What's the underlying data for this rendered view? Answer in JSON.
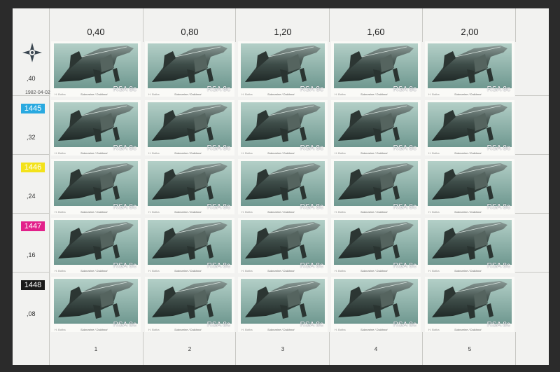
{
  "sheet": {
    "issue_date": "1982-04-02",
    "top_values": [
      "0,40",
      "0,80",
      "1,20",
      "1,60",
      "2,00"
    ],
    "row_values": [
      ",40",
      ",32",
      ",24",
      ",16",
      ",08"
    ],
    "column_numbers": [
      "1",
      "2",
      "3",
      "4",
      "5"
    ],
    "plate_numbers": [
      {
        "label": "1445",
        "color": "#29a9e0"
      },
      {
        "label": "1446",
        "color": "#f3e21a"
      },
      {
        "label": "1447",
        "color": "#e2208a"
      },
      {
        "label": "1448",
        "color": "#1a1a1a"
      }
    ]
  },
  "stamp": {
    "country_value": "RSA 8c",
    "caption": "Submarine / Duikboot",
    "designer": "H. Botha",
    "image": "submarine-illustration",
    "colors": {
      "sea": "#7fa8a0",
      "sky": "#a9c8c0",
      "hull": "#3f4e4a"
    }
  },
  "background_color": "#2b2b2b"
}
